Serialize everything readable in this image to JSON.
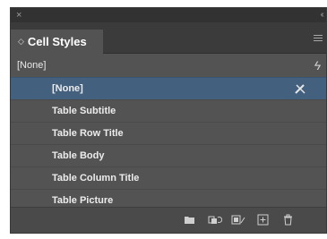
{
  "panel": {
    "titlebar": {
      "close_glyph": "×",
      "collapse_glyph": "‹‹"
    },
    "tab": {
      "updown_glyph": "◇",
      "label": "Cell Styles"
    },
    "default_style_label": "[None]",
    "styles": [
      {
        "label": "[None]",
        "selected": true
      },
      {
        "label": "Table Subtitle",
        "selected": false
      },
      {
        "label": "Table Row Title",
        "selected": false
      },
      {
        "label": "Table Body",
        "selected": false
      },
      {
        "label": "Table Column Title",
        "selected": false
      },
      {
        "label": "Table Picture",
        "selected": false
      }
    ],
    "footer_icons": [
      "folder-icon",
      "load-styles-icon",
      "clear-overrides-icon",
      "new-style-icon",
      "trash-icon"
    ],
    "colors": {
      "panel_bg": "#535353",
      "selected_row": "#43607f",
      "titlebar": "#323232"
    }
  }
}
